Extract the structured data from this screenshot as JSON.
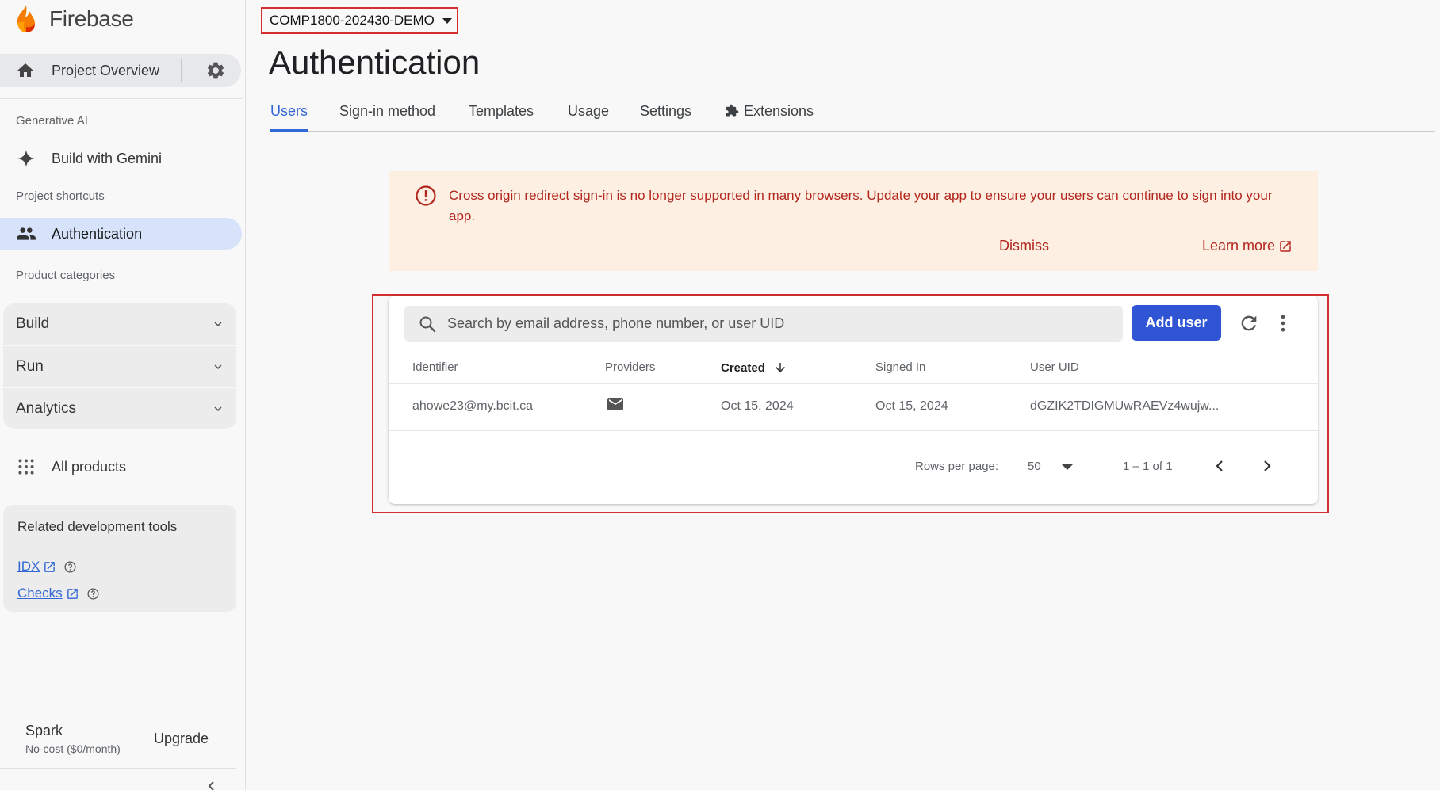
{
  "app": {
    "brand": "Firebase"
  },
  "sidebar": {
    "project_overview": "Project Overview",
    "sections": {
      "generative_ai": "Generative AI",
      "project_shortcuts": "Project shortcuts",
      "product_categories": "Product categories"
    },
    "build_with_gemini": "Build with Gemini",
    "authentication": "Authentication",
    "categories": [
      {
        "label": "Build"
      },
      {
        "label": "Run"
      },
      {
        "label": "Analytics"
      }
    ],
    "all_products": "All products",
    "tools": {
      "title": "Related development tools",
      "links": [
        {
          "label": "IDX"
        },
        {
          "label": "Checks"
        }
      ]
    },
    "plan": {
      "name": "Spark",
      "cost": "No-cost ($0/month)",
      "upgrade": "Upgrade"
    }
  },
  "header": {
    "project": "COMP1800-202430-DEMO",
    "title": "Authentication"
  },
  "tabs": [
    {
      "label": "Users",
      "active": true
    },
    {
      "label": "Sign-in method"
    },
    {
      "label": "Templates"
    },
    {
      "label": "Usage"
    },
    {
      "label": "Settings"
    },
    {
      "label": "Extensions"
    }
  ],
  "banner": {
    "message": "Cross origin redirect sign-in is no longer supported in many browsers. Update your app to ensure your users can continue to sign into your app.",
    "dismiss": "Dismiss",
    "learn_more": "Learn more"
  },
  "users": {
    "search_placeholder": "Search by email address, phone number, or user UID",
    "add_user": "Add user",
    "columns": [
      "Identifier",
      "Providers",
      "Created",
      "Signed In",
      "User UID"
    ],
    "rows": [
      {
        "identifier": "ahowe23@my.bcit.ca",
        "provider": "email-icon",
        "created": "Oct 15, 2024",
        "signed_in": "Oct 15, 2024",
        "uid": "dGZIK2TDIGMUwRAEVz4wujw..."
      }
    ],
    "rows_per_page_label": "Rows per page:",
    "rows_per_page": "50",
    "range": "1 – 1 of 1"
  },
  "colors": {
    "accent": "#3367d6",
    "primary_button": "#2f55d4",
    "banner_bg": "#fdf0e3",
    "banner_text": "#b3261e",
    "highlight_border": "#d32f2f"
  }
}
